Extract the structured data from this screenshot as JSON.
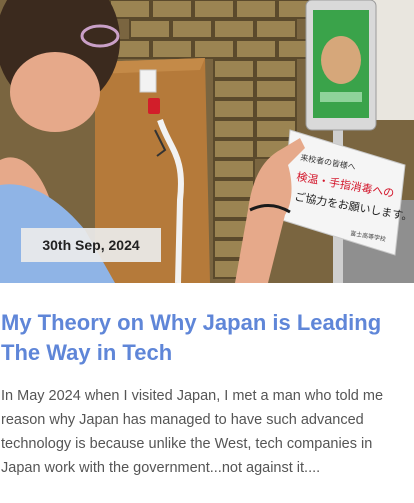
{
  "post": {
    "date": "30th Sep, 2024",
    "title": "My Theory on Why Japan is Leading The Way in Tech",
    "excerpt": "In May 2024 when I visited Japan, I met a man who told me reason why Japan has managed to have such advanced technology is because unlike the West, tech companies in Japan work with the government...not against it....",
    "image": {
      "sign_line1": "検温・手指消毒への",
      "sign_line2": "ご協力をお願いします。",
      "sign_footer": "富士高等学校",
      "sign_header": "来校者の皆様へ"
    }
  },
  "colors": {
    "title": "#5f86d8",
    "excerpt": "#555555",
    "badge_bg": "#ebebeb"
  }
}
